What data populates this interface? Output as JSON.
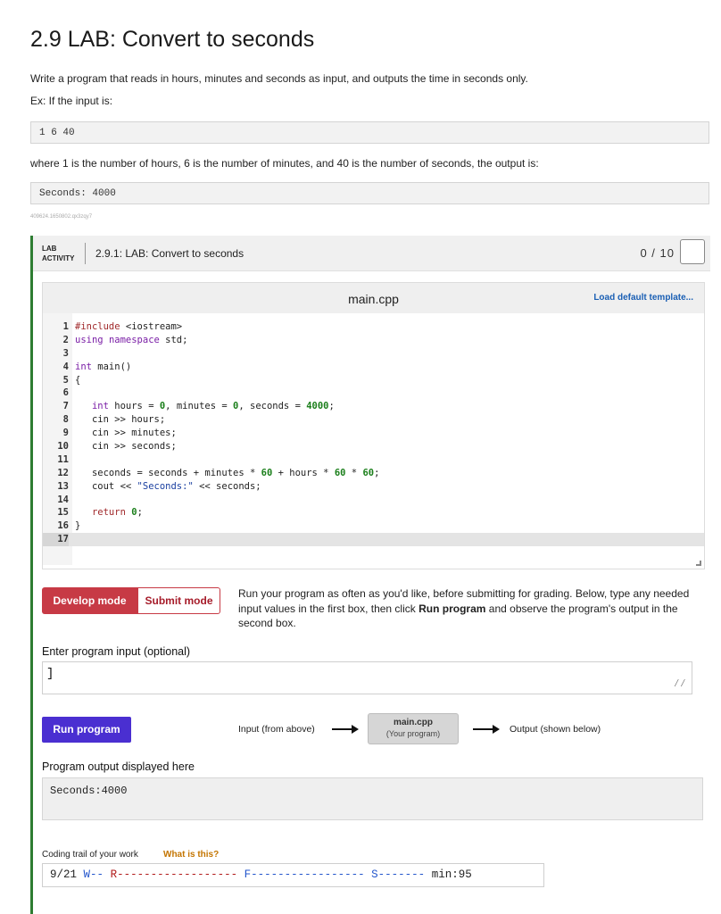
{
  "page": {
    "title": "2.9 LAB: Convert to seconds",
    "description": "Write a program that reads in hours, minutes and seconds as input, and outputs the time in seconds only.",
    "example_intro": "Ex: If the input is:",
    "example_input": "1 6 40",
    "explanation": "where 1 is the number of hours, 6 is the number of minutes, and 40 is the number of seconds, the output is:",
    "example_output": "Seconds: 4000",
    "tracking_id": "409624.1650802.qx3zqy7"
  },
  "lab": {
    "badge_line1": "LAB",
    "badge_line2": "ACTIVITY",
    "title": "2.9.1: LAB: Convert to seconds",
    "score": "0 / 10",
    "accent_color": "#2e7d32"
  },
  "editor": {
    "filename": "main.cpp",
    "load_template": "Load default template...",
    "lines": [
      {
        "n": "1",
        "text": "#include <iostream>"
      },
      {
        "n": "2",
        "text": "using namespace std;"
      },
      {
        "n": "3",
        "text": ""
      },
      {
        "n": "4",
        "text": "int main()"
      },
      {
        "n": "5",
        "text": "{"
      },
      {
        "n": "6",
        "text": ""
      },
      {
        "n": "7",
        "text": "   int hours = 0, minutes = 0, seconds = 4000;"
      },
      {
        "n": "8",
        "text": "   cin >> hours;"
      },
      {
        "n": "9",
        "text": "   cin >> minutes;"
      },
      {
        "n": "10",
        "text": "   cin >> seconds;"
      },
      {
        "n": "11",
        "text": ""
      },
      {
        "n": "12",
        "text": "   seconds = seconds + minutes * 60 + hours * 60 * 60;"
      },
      {
        "n": "13",
        "text": "   cout << \"Seconds:\" << seconds;"
      },
      {
        "n": "14",
        "text": ""
      },
      {
        "n": "15",
        "text": "   return 0;"
      },
      {
        "n": "16",
        "text": "}"
      },
      {
        "n": "17",
        "text": ""
      }
    ],
    "active_line": "17"
  },
  "modes": {
    "develop": "Develop mode",
    "submit": "Submit mode",
    "develop_color": "#c73a45"
  },
  "instructions": {
    "part1": "Run your program as often as you'd like, before submitting for grading. Below, type any needed input values in the first box, then click ",
    "bold": "Run program",
    "part2": " and observe the program's output in the second box."
  },
  "input": {
    "label": "Enter program input (optional)",
    "value": ""
  },
  "run": {
    "button": "Run program",
    "button_color": "#4a2fd1",
    "flow_input": "Input (from above)",
    "flow_file": "main.cpp",
    "flow_file_sub": "(Your program)",
    "flow_output": "Output (shown below)"
  },
  "output": {
    "label": "Program output displayed here",
    "value": "Seconds:4000"
  },
  "trail": {
    "label": "Coding trail of your work",
    "link": "What is this?",
    "date": "9/21",
    "w": "W--",
    "r": "R------------------",
    "f": "F-----------------",
    "s": "S-------",
    "min": "min:95"
  }
}
